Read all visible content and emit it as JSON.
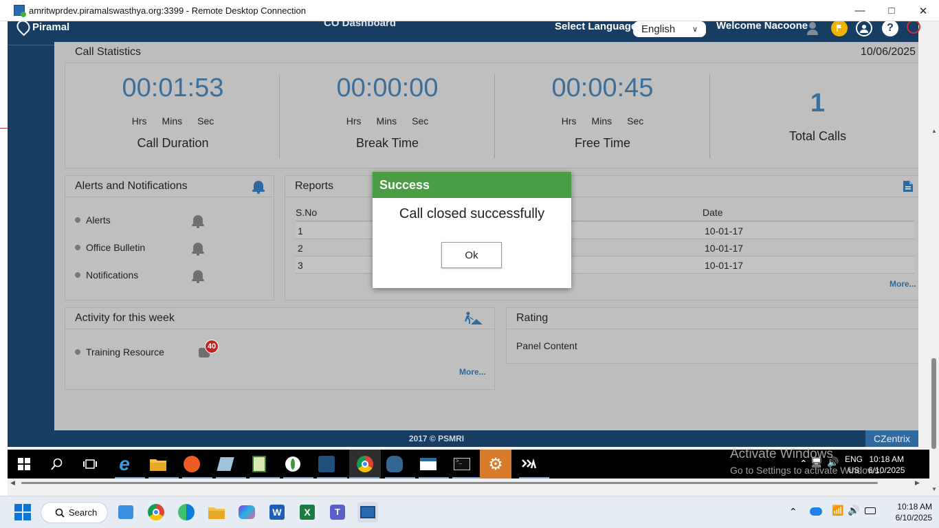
{
  "window": {
    "title": "amritwprdev.piramalswasthya.org:3399 - Remote Desktop Connection",
    "minimize": "—",
    "maximize": "□",
    "close": "✕"
  },
  "app_header": {
    "logo_text": "Piramal",
    "title": "CO Dashboard",
    "language_label": "Select Language:",
    "language_value": "English",
    "welcome": "Welcome Nacoone"
  },
  "call_statistics": {
    "title": "Call Statistics",
    "date": "10/06/2025",
    "stats": [
      {
        "value": "00:01:53",
        "units": [
          "Hrs",
          "Mins",
          "Sec"
        ],
        "label": "Call Duration"
      },
      {
        "value": "00:00:00",
        "units": [
          "Hrs",
          "Mins",
          "Sec"
        ],
        "label": "Break Time"
      },
      {
        "value": "00:00:45",
        "units": [
          "Hrs",
          "Mins",
          "Sec"
        ],
        "label": "Free Time"
      },
      {
        "value": "1",
        "label": "Total Calls"
      }
    ]
  },
  "alerts_panel": {
    "title": "Alerts and Notifications",
    "items": [
      "Alerts",
      "Office Bulletin",
      "Notifications"
    ]
  },
  "reports_panel": {
    "title": "Reports",
    "columns": [
      "S.No",
      "Date"
    ],
    "rows": [
      {
        "sno": "1",
        "date": "10-01-17"
      },
      {
        "sno": "2",
        "date": "10-01-17"
      },
      {
        "sno": "3",
        "date": "10-01-17"
      }
    ],
    "more": "More..."
  },
  "activity_panel": {
    "title": "Activity for this week",
    "items": [
      {
        "label": "Training Resource",
        "badge": "40"
      }
    ],
    "more": "More..."
  },
  "rating_panel": {
    "title": "Rating",
    "content": "Panel Content"
  },
  "app_footer": {
    "copyright": "2017 © PSMRI",
    "brand": "CZentrix"
  },
  "remote_taskbar": {
    "activate_title": "Activate Windows",
    "activate_sub": "Go to Settings to activate Windows.",
    "lang": "ENG",
    "region": "US",
    "time": "10:18 AM",
    "date": "6/10/2025"
  },
  "modal": {
    "title": "Success",
    "message": "Call closed successfully",
    "ok_label": "Ok"
  },
  "host_taskbar": {
    "search_label": "Search",
    "time": "10:18 AM",
    "date": "6/10/2025"
  },
  "colors": {
    "header_bg": "#173d63",
    "stat_value": "#3c6f9a",
    "modal_success": "#4a9d44",
    "badge_red": "#c62020"
  }
}
